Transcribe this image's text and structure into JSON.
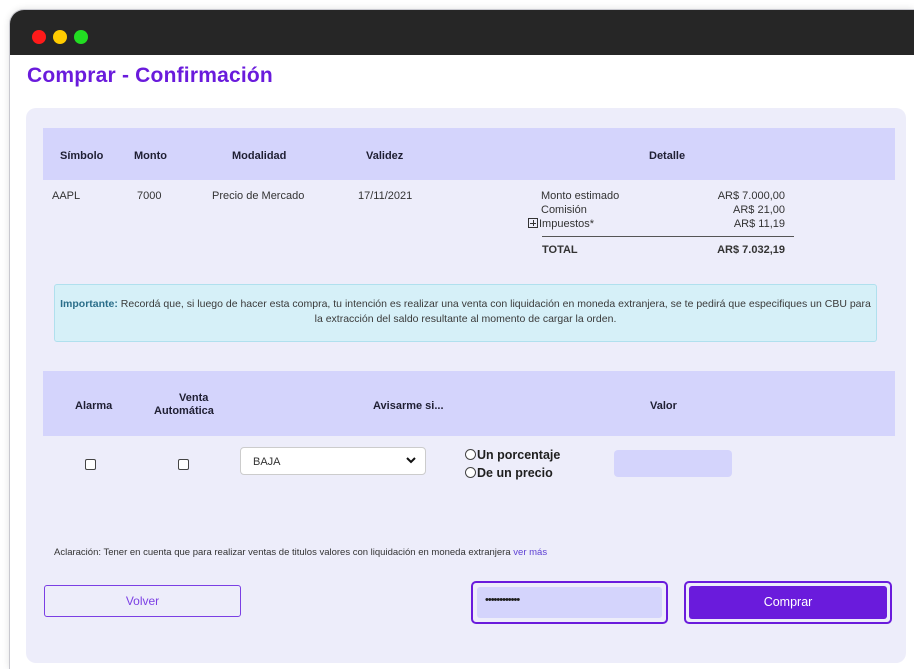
{
  "window": {
    "colors": {
      "close": "#ff1a1a",
      "minimize": "#ffcc00",
      "maximize": "#22dd22"
    }
  },
  "page": {
    "title": "Comprar - Confirmación",
    "accent": "#6a1bdc"
  },
  "order_table": {
    "headers": [
      "Símbolo",
      "Monto",
      "Modalidad",
      "Validez",
      "Detalle"
    ],
    "row": {
      "simbolo": "AAPL",
      "monto": "7000",
      "modalidad": "Precio de Mercado",
      "validez": "17/11/2021"
    },
    "detail": {
      "items": [
        {
          "label": "Monto estimado",
          "value": "AR$ 7.000,00"
        },
        {
          "label": "Comisión",
          "value": "AR$ 21,00"
        },
        {
          "label": "Impuestos*",
          "value": "AR$ 11,19"
        }
      ],
      "total_label": "TOTAL",
      "total_value": "AR$ 7.032,19"
    }
  },
  "notice": {
    "bold": "Importante:",
    "text": " Recordá que, si luego de hacer esta compra, tu intención es realizar una venta con liquidación en moneda extranjera, se te pedirá que especifiques un CBU para la extracción del saldo resultante al momento de cargar la orden."
  },
  "alarm_table": {
    "headers": {
      "alarma": "Alarma",
      "venta_line1": "Venta",
      "venta_line2": "Automática",
      "avisarme": "Avisarme si...",
      "valor": "Valor"
    },
    "select_value": "BAJA",
    "radio_options": [
      "Un porcentaje",
      "De un precio"
    ],
    "valor_value": ""
  },
  "aclaracion": {
    "text": "Aclaración: Tener en cuenta que para realizar ventas de titulos valores con liquidación en moneda extranjera ",
    "link": "ver más"
  },
  "actions": {
    "volver": "Volver",
    "password_value": "••••••••••••",
    "comprar": "Comprar"
  }
}
